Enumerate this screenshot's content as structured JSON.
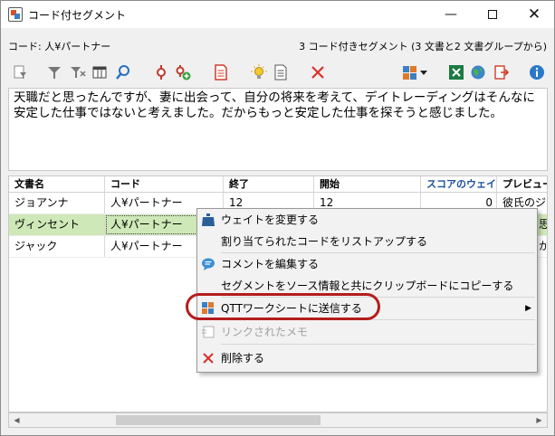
{
  "window": {
    "title": "コード付セグメント"
  },
  "info": {
    "left": "コード: 人¥パートナー",
    "right": "3 コード付きセグメント (3 文書と2 文書グループから)"
  },
  "toolbar": {
    "icons": [
      "page-filter-icon",
      "filter-icon",
      "clear-filter-icon",
      "columns-icon",
      "search-icon",
      "code-branch-icon",
      "code-add-icon",
      "document-icon",
      "lightbulb-icon",
      "list-icon",
      "delete-icon",
      "qtt-dropdown-icon",
      "excel-icon",
      "web-export-icon",
      "export-icon",
      "info-icon"
    ]
  },
  "text": "天職だと思ったんですが、妻に出会って、自分の将来を考えて、デイトレーディングはそんなに安定した仕事ではないと考えました。だからもっと安定した仕事を探そうと感じました。",
  "table": {
    "headers": [
      "文書名",
      "コード",
      "終了",
      "開始",
      "スコアのウェイト",
      "プレビュー"
    ],
    "rows": [
      [
        "ジョアンナ",
        "人¥パートナー",
        "12",
        "12",
        "0",
        "彼氏のジョ"
      ],
      [
        "ヴィンセント",
        "人¥パートナー",
        "",
        "",
        "",
        "思"
      ],
      [
        "ジャック",
        "人¥パートナー",
        "",
        "",
        "",
        "か"
      ]
    ]
  },
  "menu": {
    "items": [
      {
        "label": "ウェイトを変更する",
        "icon": "weight-icon"
      },
      {
        "label": "割り当てられたコードをリストアップする",
        "icon": ""
      },
      {
        "label": "コメントを編集する",
        "icon": "comment-icon"
      },
      {
        "label": "セグメントをソース情報と共にクリップボードにコピーする",
        "icon": ""
      },
      {
        "label": "QTTワークシートに送信する",
        "icon": "qtt-icon",
        "submenu": "▶"
      },
      {
        "label": "リンクされたメモ",
        "icon": "memo-icon",
        "disabled": true
      },
      {
        "label": "削除する",
        "icon": "delete-icon"
      }
    ]
  },
  "colors": {
    "selection": "#cfe8b8",
    "highlight_ring": "#b51c1c",
    "score_header": "#1a4fa0"
  }
}
